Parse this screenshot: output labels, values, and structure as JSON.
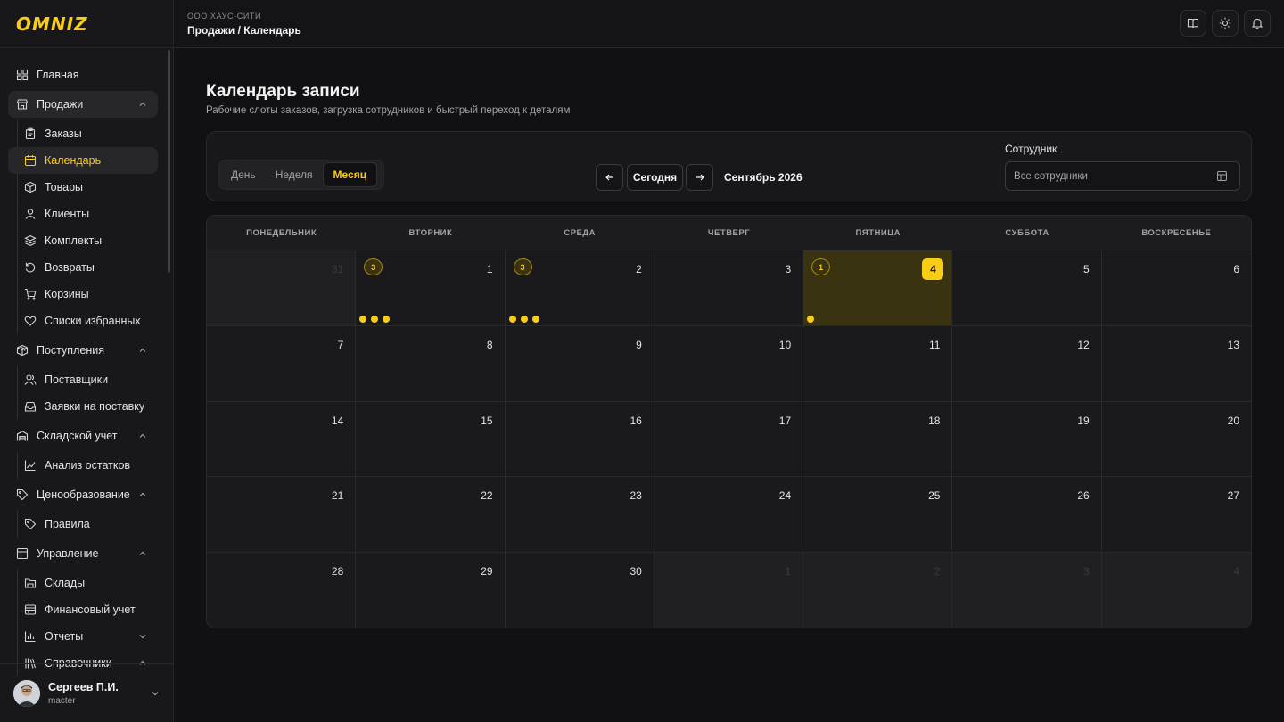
{
  "app": {
    "logo": "OMNIZ"
  },
  "topbar": {
    "org": "ООО ХАУС-СИТИ",
    "breadcrumb": "Продажи / Календарь",
    "icons": [
      "book-icon",
      "sun-icon",
      "bell-icon"
    ]
  },
  "sidebar": {
    "items": [
      {
        "label": "Главная",
        "icon": "dashboard-icon",
        "level": 0
      },
      {
        "label": "Продажи",
        "icon": "store-icon",
        "level": 0,
        "expanded": true
      },
      {
        "label": "Заказы",
        "icon": "clipboard-icon",
        "level": 1
      },
      {
        "label": "Календарь",
        "icon": "calendar-icon",
        "level": 1,
        "current": true
      },
      {
        "label": "Товары",
        "icon": "box-icon",
        "level": 1
      },
      {
        "label": "Клиенты",
        "icon": "user-icon",
        "level": 1
      },
      {
        "label": "Комплекты",
        "icon": "layers-icon",
        "level": 1
      },
      {
        "label": "Возвраты",
        "icon": "return-icon",
        "level": 1
      },
      {
        "label": "Корзины",
        "icon": "cart-icon",
        "level": 1
      },
      {
        "label": "Списки избранных",
        "icon": "heart-icon",
        "level": 1
      },
      {
        "label": "Поступления",
        "icon": "package-icon",
        "level": 0,
        "expanded": true
      },
      {
        "label": "Поставщики",
        "icon": "users-icon",
        "level": 1
      },
      {
        "label": "Заявки на поставку",
        "icon": "inbox-icon",
        "level": 1
      },
      {
        "label": "Складской учет",
        "icon": "warehouse-icon",
        "level": 0,
        "expanded": true
      },
      {
        "label": "Анализ остатков",
        "icon": "chart-line-icon",
        "level": 1
      },
      {
        "label": "Ценообразование",
        "icon": "tag-icon",
        "level": 0,
        "expanded": true
      },
      {
        "label": "Правила",
        "icon": "tag-icon",
        "level": 1
      },
      {
        "label": "Управление",
        "icon": "layout-icon",
        "level": 0,
        "expanded": true
      },
      {
        "label": "Склады",
        "icon": "folder-icon",
        "level": 1
      },
      {
        "label": "Финансовый учет",
        "icon": "wallet-icon",
        "level": 1
      },
      {
        "label": "Отчеты",
        "icon": "bar-chart-icon",
        "level": 1,
        "collapsed": true
      },
      {
        "label": "Справочники",
        "icon": "library-icon",
        "level": 1,
        "expanded": true
      }
    ]
  },
  "user": {
    "name": "Сергеев П.И.",
    "role": "master"
  },
  "page": {
    "title": "Календарь записи",
    "subtitle": "Рабочие слоты заказов, загрузка сотрудников и быстрый переход к деталям"
  },
  "toolbar": {
    "views": [
      "День",
      "Неделя",
      "Месяц"
    ],
    "active_view": "Месяц",
    "today_label": "Сегодня",
    "month_label": "Сентябрь 2026",
    "employee_label": "Сотрудник",
    "employee_value": "Все сотрудники"
  },
  "calendar": {
    "weekdays": [
      "ПОНЕДЕЛЬНИК",
      "ВТОРНИК",
      "СРЕДА",
      "ЧЕТВЕРГ",
      "ПЯТНИЦА",
      "СУББОТА",
      "ВОСКРЕСЕНЬЕ"
    ],
    "days": [
      {
        "day": "31",
        "out": true
      },
      {
        "day": "1",
        "count": "3",
        "dots": 3
      },
      {
        "day": "2",
        "count": "3",
        "dots": 3
      },
      {
        "day": "3"
      },
      {
        "day": "4",
        "count": "1",
        "dots": 1,
        "today": true
      },
      {
        "day": "5"
      },
      {
        "day": "6"
      },
      {
        "day": "7"
      },
      {
        "day": "8"
      },
      {
        "day": "9"
      },
      {
        "day": "10"
      },
      {
        "day": "11"
      },
      {
        "day": "12"
      },
      {
        "day": "13"
      },
      {
        "day": "14"
      },
      {
        "day": "15"
      },
      {
        "day": "16"
      },
      {
        "day": "17"
      },
      {
        "day": "18"
      },
      {
        "day": "19"
      },
      {
        "day": "20"
      },
      {
        "day": "21"
      },
      {
        "day": "22"
      },
      {
        "day": "23"
      },
      {
        "day": "24"
      },
      {
        "day": "25"
      },
      {
        "day": "26"
      },
      {
        "day": "27"
      },
      {
        "day": "28"
      },
      {
        "day": "29"
      },
      {
        "day": "30"
      },
      {
        "day": "1",
        "out": true
      },
      {
        "day": "2",
        "out": true
      },
      {
        "day": "3",
        "out": true
      },
      {
        "day": "4",
        "out": true
      }
    ]
  },
  "colors": {
    "accent": "#facc15",
    "bg": "#111113",
    "panel": "#18181b",
    "today_bg": "#3a3312"
  }
}
